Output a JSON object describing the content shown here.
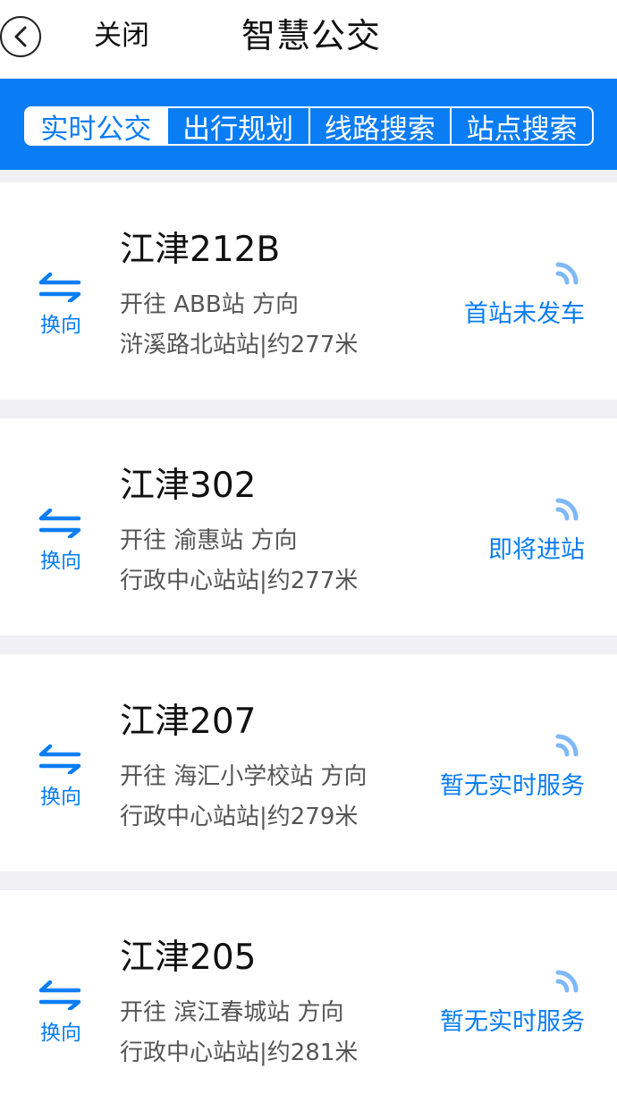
{
  "header": {
    "close_label": "关闭",
    "title": "智慧公交",
    "back_icon": "chevron-left-circle-icon"
  },
  "tabs": [
    {
      "label": "实时公交",
      "active": true
    },
    {
      "label": "出行规划",
      "active": false
    },
    {
      "label": "线路搜索",
      "active": false
    },
    {
      "label": "站点搜索",
      "active": false
    }
  ],
  "colors": {
    "accent": "#0a7df5",
    "signal": "#7fb8f7",
    "background": "#efeff4"
  },
  "routes": [
    {
      "name": "江津212B",
      "direction": "开往 ABB站 方向",
      "stop": "浒溪路北站站|约277米",
      "status": "首站未发车",
      "swap_label": "换向"
    },
    {
      "name": "江津302",
      "direction": "开往 渝惠站 方向",
      "stop": "行政中心站站|约277米",
      "status": "即将进站",
      "swap_label": "换向"
    },
    {
      "name": "江津207",
      "direction": "开往 海汇小学校站 方向",
      "stop": "行政中心站站|约279米",
      "status": "暂无实时服务",
      "swap_label": "换向"
    },
    {
      "name": "江津205",
      "direction": "开往 滨江春城站 方向",
      "stop": "行政中心站站|约281米",
      "status": "暂无实时服务",
      "swap_label": "换向"
    }
  ]
}
